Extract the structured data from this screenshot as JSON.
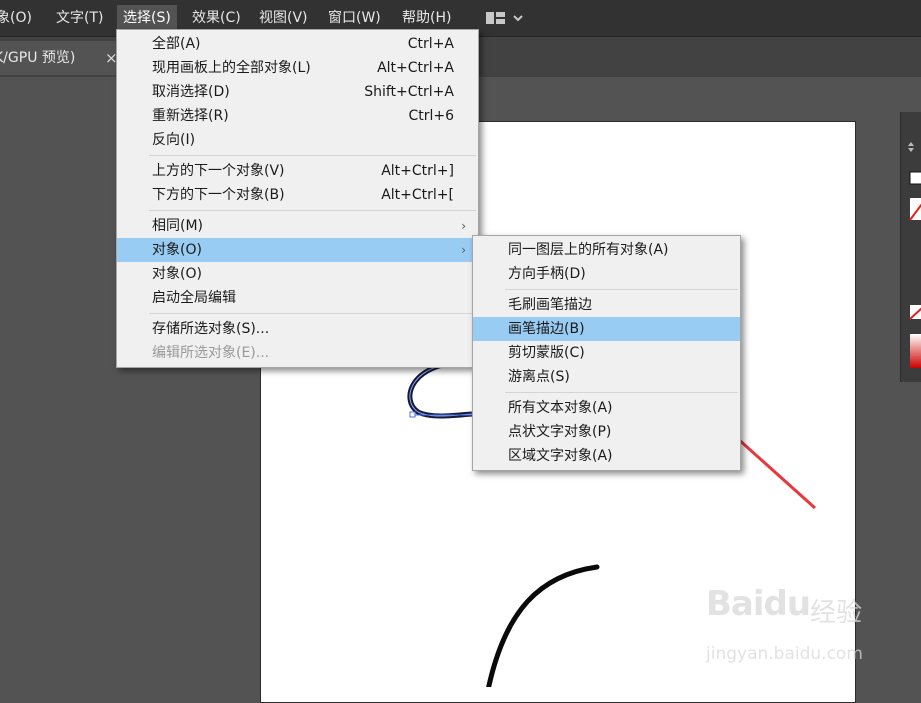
{
  "menubar": {
    "items": [
      {
        "label": "象(O)"
      },
      {
        "label": "文字(T)"
      },
      {
        "label": "选择(S)"
      },
      {
        "label": "效果(C)"
      },
      {
        "label": "视图(V)"
      },
      {
        "label": "窗口(W)"
      },
      {
        "label": "帮助(H)"
      }
    ],
    "layout_icon": "workspace-layout-icon",
    "dropdown_icon": "chevron-down-icon"
  },
  "tab": {
    "label": "K/GPU 预览)",
    "close": "×"
  },
  "select_menu": {
    "groups": [
      [
        {
          "label": "全部(A)",
          "shortcut": "Ctrl+A"
        },
        {
          "label": "现用画板上的全部对象(L)",
          "shortcut": "Alt+Ctrl+A"
        },
        {
          "label": "取消选择(D)",
          "shortcut": "Shift+Ctrl+A"
        },
        {
          "label": "重新选择(R)",
          "shortcut": "Ctrl+6"
        },
        {
          "label": "反向(I)",
          "shortcut": ""
        }
      ],
      [
        {
          "label": "上方的下一个对象(V)",
          "shortcut": "Alt+Ctrl+]"
        },
        {
          "label": "下方的下一个对象(B)",
          "shortcut": "Alt+Ctrl+["
        }
      ],
      [
        {
          "label": "相同(M)",
          "submenu": true
        },
        {
          "label": "对象(O)",
          "submenu": true,
          "highlighted": true
        },
        {
          "label": "对象(O)"
        },
        {
          "label": "启动全局编辑"
        }
      ],
      [
        {
          "label": "存储所选对象(S)..."
        },
        {
          "label": "编辑所选对象(E)...",
          "disabled": true
        }
      ]
    ]
  },
  "object_submenu": {
    "groups": [
      [
        {
          "label": "同一图层上的所有对象(A)"
        },
        {
          "label": "方向手柄(D)"
        }
      ],
      [
        {
          "label": "毛刷画笔描边"
        },
        {
          "label": "画笔描边(B)",
          "highlighted": true
        },
        {
          "label": "剪切蒙版(C)"
        },
        {
          "label": "游离点(S)"
        }
      ],
      [
        {
          "label": "所有文本对象(A)"
        },
        {
          "label": "点状文字对象(P)"
        },
        {
          "label": "区域文字对象(A)"
        }
      ]
    ]
  },
  "annotation": {
    "arrow_color": "#e8383d"
  },
  "watermark": {
    "logo": "Baidu",
    "cn": "经验",
    "url": "jingyan.baidu.com"
  },
  "colors": {
    "menubar_bg": "#323232",
    "menu_bg": "#f0f0f0",
    "highlight": "#99ccf3",
    "workspace": "#535353"
  }
}
